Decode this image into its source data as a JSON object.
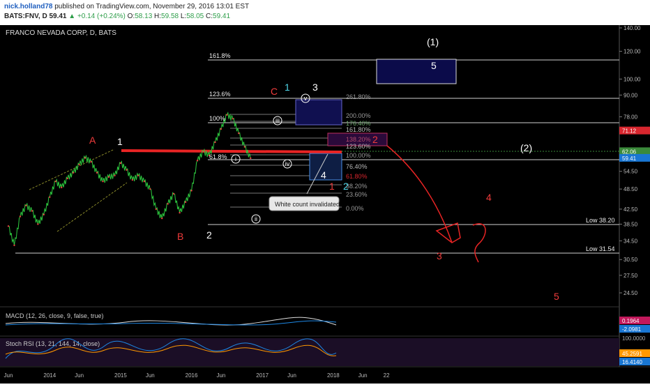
{
  "header": {
    "author": "nick.holland78",
    "published_text": "published on TradingView.com, November 29, 2016 13:01 EST",
    "symbol": "BATS:FNV, D",
    "last": "59.41",
    "change": "▲ +0.14 (+0.24%)",
    "open_label": "O:",
    "open": "58.13",
    "high_label": "H:",
    "high": "59.58",
    "low_label": "L:",
    "low": "58.05",
    "close_label": "C:",
    "close": "59.41"
  },
  "chart_data": {
    "type": "line",
    "title": "FRANCO NEVADA CORP, D, BATS",
    "y_scale": "log",
    "ylim": [
      22.5,
      145
    ],
    "y_ticks": [
      "140.00",
      "120.00",
      "100.00",
      "90.00",
      "78.00",
      "71.12",
      "62.06",
      "59.41",
      "54.50",
      "48.50",
      "42.50",
      "38.50",
      "34.50",
      "30.50",
      "27.50",
      "24.50"
    ],
    "price_tags": [
      {
        "value": "71.12",
        "y": 71.12,
        "color": "#d8262e"
      },
      {
        "value": "62.06",
        "y": 62.06,
        "color": "#3a8a3a"
      },
      {
        "value": "59.41",
        "y": 59.41,
        "color": "#1976d2"
      }
    ],
    "x_ticks": [
      {
        "label": "Jun",
        "date": "2013-06"
      },
      {
        "label": "2014",
        "date": "2014-01"
      },
      {
        "label": "Jun",
        "date": "2014-06"
      },
      {
        "label": "2015",
        "date": "2015-01"
      },
      {
        "label": "Jun",
        "date": "2015-06"
      },
      {
        "label": "2016",
        "date": "2016-01"
      },
      {
        "label": "Jun",
        "date": "2016-06"
      },
      {
        "label": "2017",
        "date": "2017-01"
      },
      {
        "label": "Jun",
        "date": "2017-06"
      },
      {
        "label": "2018",
        "date": "2018-01"
      },
      {
        "label": "Jun",
        "date": "2018-06"
      },
      {
        "label": "22",
        "date": "2018-10"
      }
    ],
    "series": [
      {
        "points": [
          [
            "2013-06",
            38.0
          ],
          [
            "2013-07",
            33.5
          ],
          [
            "2013-08",
            40.5
          ],
          [
            "2013-09",
            43.5
          ],
          [
            "2013-10",
            42.0
          ],
          [
            "2013-11",
            38.5
          ],
          [
            "2013-12",
            41.0
          ],
          [
            "2014-01",
            46.0
          ],
          [
            "2014-02",
            51.0
          ],
          [
            "2014-03",
            49.0
          ],
          [
            "2014-04",
            52.0
          ],
          [
            "2014-05",
            54.0
          ],
          [
            "2014-06",
            57.0
          ],
          [
            "2014-07",
            59.5
          ],
          [
            "2014-08",
            58.0
          ],
          [
            "2014-09",
            54.0
          ],
          [
            "2014-10",
            51.0
          ],
          [
            "2014-11",
            52.5
          ],
          [
            "2014-12",
            53.0
          ],
          [
            "2015-01",
            57.5
          ],
          [
            "2015-02",
            55.0
          ],
          [
            "2015-03",
            51.5
          ],
          [
            "2015-04",
            53.0
          ],
          [
            "2015-05",
            51.0
          ],
          [
            "2015-06",
            48.5
          ],
          [
            "2015-07",
            42.5
          ],
          [
            "2015-08",
            40.0
          ],
          [
            "2015-09",
            44.0
          ],
          [
            "2015-10",
            47.0
          ],
          [
            "2015-11",
            41.5
          ],
          [
            "2015-12",
            44.5
          ],
          [
            "2016-01",
            48.0
          ],
          [
            "2016-02",
            58.5
          ],
          [
            "2016-03",
            62.0
          ],
          [
            "2016-04",
            60.5
          ],
          [
            "2016-05",
            66.0
          ],
          [
            "2016-06",
            72.0
          ],
          [
            "2016-07",
            79.0
          ],
          [
            "2016-08",
            77.0
          ],
          [
            "2016-09",
            70.0
          ],
          [
            "2016-10",
            64.0
          ],
          [
            "2016-11",
            59.41
          ]
        ]
      }
    ],
    "fib_right_labels": [
      "261.80%",
      "200.00%",
      "176.40%",
      "161.80%",
      "138.20%",
      "123.60%",
      "100.00%",
      "76.40%",
      "61.80%",
      "38.20%",
      "23.60%",
      "0.00%"
    ],
    "fib_left_labels": [
      "161.8%",
      "123.6%",
      "100%",
      "61.8%"
    ],
    "horizontal_labels": [
      "Low 38.20",
      "Low 31.54"
    ],
    "wave_labels_white": [
      "1",
      "2",
      "3",
      "(1)",
      "(2)",
      "5",
      "4"
    ],
    "wave_labels_red": [
      "A",
      "B",
      "C",
      "2",
      "1",
      "3",
      "4",
      "5"
    ],
    "wave_labels_cyan": [
      "1",
      "2"
    ],
    "circled_labels": [
      "i",
      "ii",
      "iii",
      "iv",
      "v"
    ],
    "annotation": "White count invalidated",
    "indicators": {
      "macd_label": "MACD (12, 26, close, 9, false, true)",
      "macd_values": [
        "0.1964",
        "-2.0981"
      ],
      "stoch_label": "Stoch RSI (13, 21, 144, 14, close)",
      "stoch_axis": [
        "100.0000",
        "0.0000"
      ],
      "stoch_values": [
        "45.2591",
        "16.4140"
      ]
    }
  }
}
